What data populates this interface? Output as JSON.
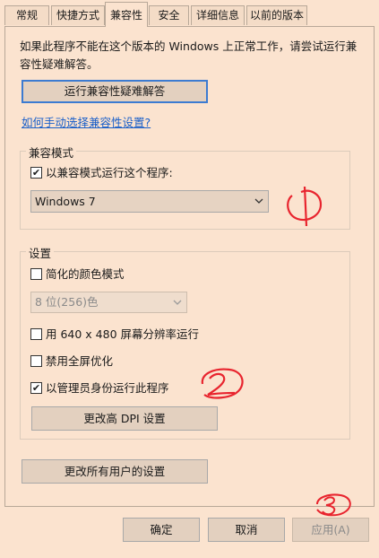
{
  "tabs": [
    "常规",
    "快捷方式",
    "兼容性",
    "安全",
    "详细信息",
    "以前的版本"
  ],
  "active_tab": "兼容性",
  "intro": {
    "line1": "如果此程序不能在这个版本的 Windows 上正常工作，请尝试运行兼",
    "line2": "容性疑难解答。"
  },
  "troubleshooter_button": "运行兼容性疑难解答",
  "manual_link": "如何手动选择兼容性设置?",
  "compat_group": {
    "title": "兼容模式",
    "checkbox_label": "以兼容模式运行这个程序:",
    "checked": true,
    "selected_os": "Windows 7"
  },
  "settings_group": {
    "title": "设置",
    "reduced_color_label": "简化的颜色模式",
    "reduced_color_checked": false,
    "color_select": "8 位(256)色",
    "res_640_label": "用 640 x 480 屏幕分辨率运行",
    "res_640_checked": false,
    "fullscreen_opt_label": "禁用全屏优化",
    "fullscreen_opt_checked": false,
    "admin_label": "以管理员身份运行此程序",
    "admin_checked": true,
    "dpi_button": "更改高 DPI 设置"
  },
  "all_users_button": "更改所有用户的设置",
  "footer": {
    "ok": "确定",
    "cancel": "取消",
    "apply": "应用(A)"
  },
  "checkmark_glyph": "✔",
  "annotation_color": "#e8242e",
  "annotations": [
    "1",
    "2",
    "3"
  ]
}
